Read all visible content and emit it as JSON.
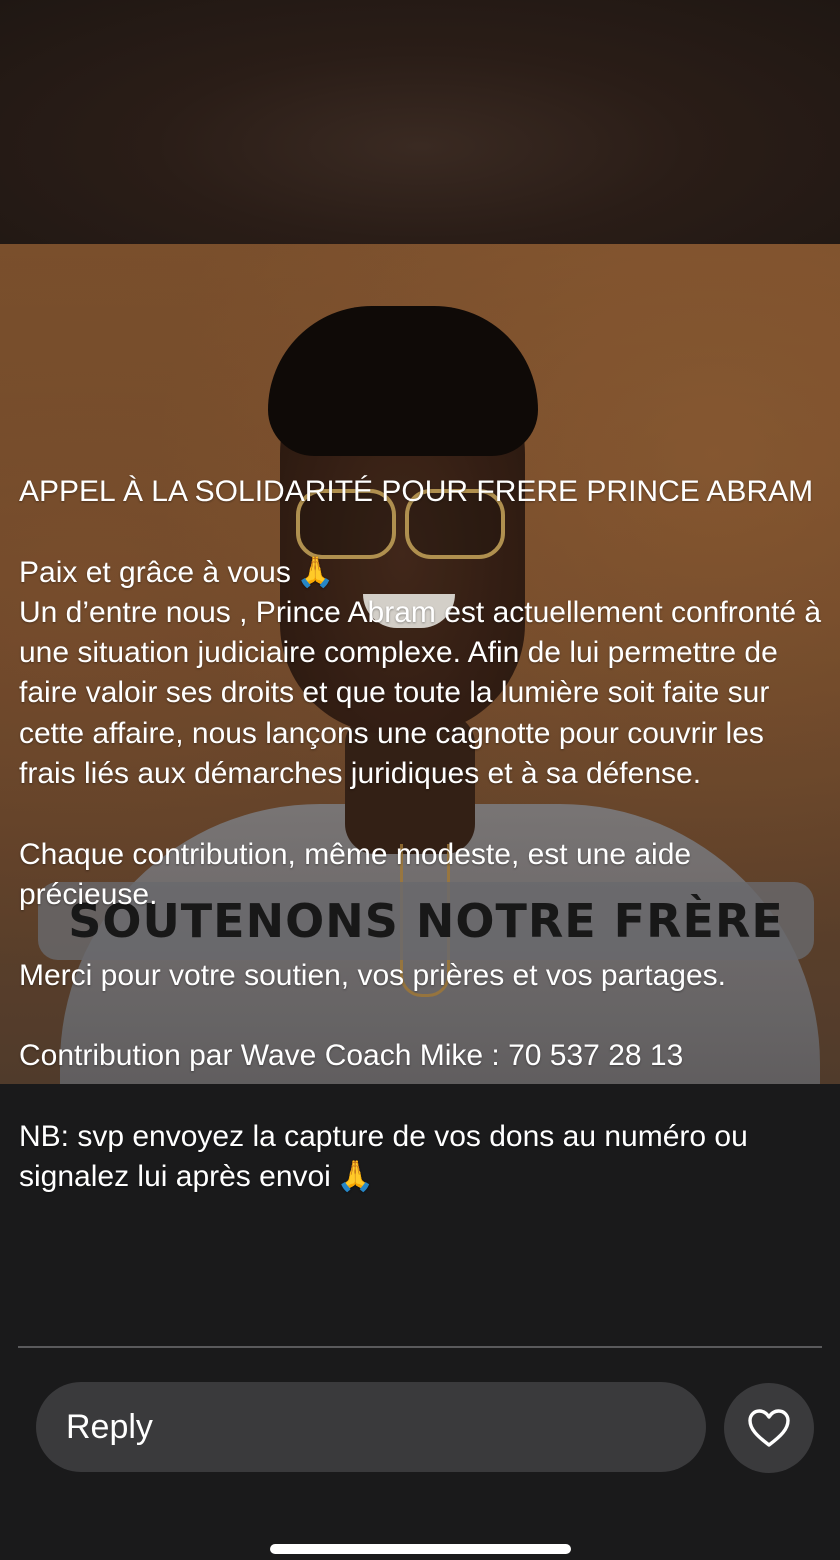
{
  "story": {
    "image_banner_text": "SOUTENONS NOTRE FRÈRE",
    "caption": {
      "title": "APPEL À LA SOLIDARITÉ POUR FRERE PRINCE ABRAM",
      "greeting": "Paix et grâce à vous",
      "greeting_emoji": "🙏",
      "body": "Un d’entre nous , Prince Abram  est actuellement confronté à une situation judiciaire complexe. Afin de lui permettre de faire valoir ses droits et que toute la lumière soit faite sur cette affaire, nous lançons une cagnotte pour couvrir les frais liés aux démarches juridiques et à sa défense.",
      "contribution_note": "Chaque contribution, même modeste, est une aide précieuse.",
      "thanks": "Merci pour votre soutien, vos prières et vos partages.",
      "contribution_info": "Contribution par Wave Coach Mike : 70 537 28 13",
      "nb": "NB: svp envoyez la capture de vos dons au numéro ou signalez lui après envoi",
      "nb_emoji": "🙏"
    }
  },
  "reply_bar": {
    "reply_placeholder": "Reply",
    "like_icon": "heart-icon"
  },
  "colors": {
    "background": "#1a1a1b",
    "pill": "#3a3a3c",
    "text": "#ffffff"
  }
}
